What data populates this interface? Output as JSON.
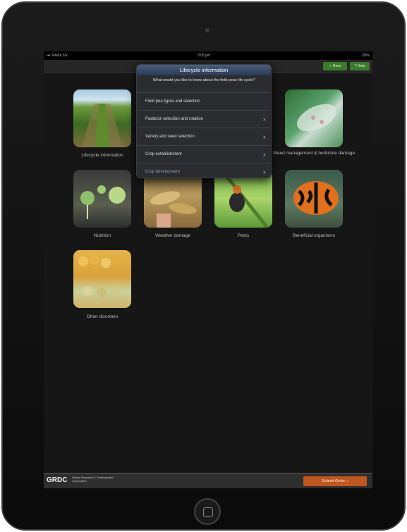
{
  "status": {
    "carrier": "••• Telstra  3G",
    "time": "3:05 pm",
    "battery": "85%"
  },
  "toolbar": {
    "btn1": "✓ Done",
    "btn2": "? Help"
  },
  "popover": {
    "title": "Lifecycle information",
    "question": "What would you like to know about the field peas life cycle?",
    "items": [
      "Field pea types and selection",
      "Paddock selection and rotation",
      "Variety and seed selection",
      "Crop establishment",
      "Crop development"
    ]
  },
  "tiles": [
    {
      "label": "Lifecycle information"
    },
    {
      "label": "Weed management & herbicide damage"
    },
    {
      "label": "Nutrition"
    },
    {
      "label": "Weather damage"
    },
    {
      "label": "Pests"
    },
    {
      "label": "Beneficial organisms"
    },
    {
      "label": "Other disorders"
    }
  ],
  "footer": {
    "logo": "GRDC",
    "org": "Grains Research & Development Corporation",
    "button": "Submit Order ↓"
  }
}
